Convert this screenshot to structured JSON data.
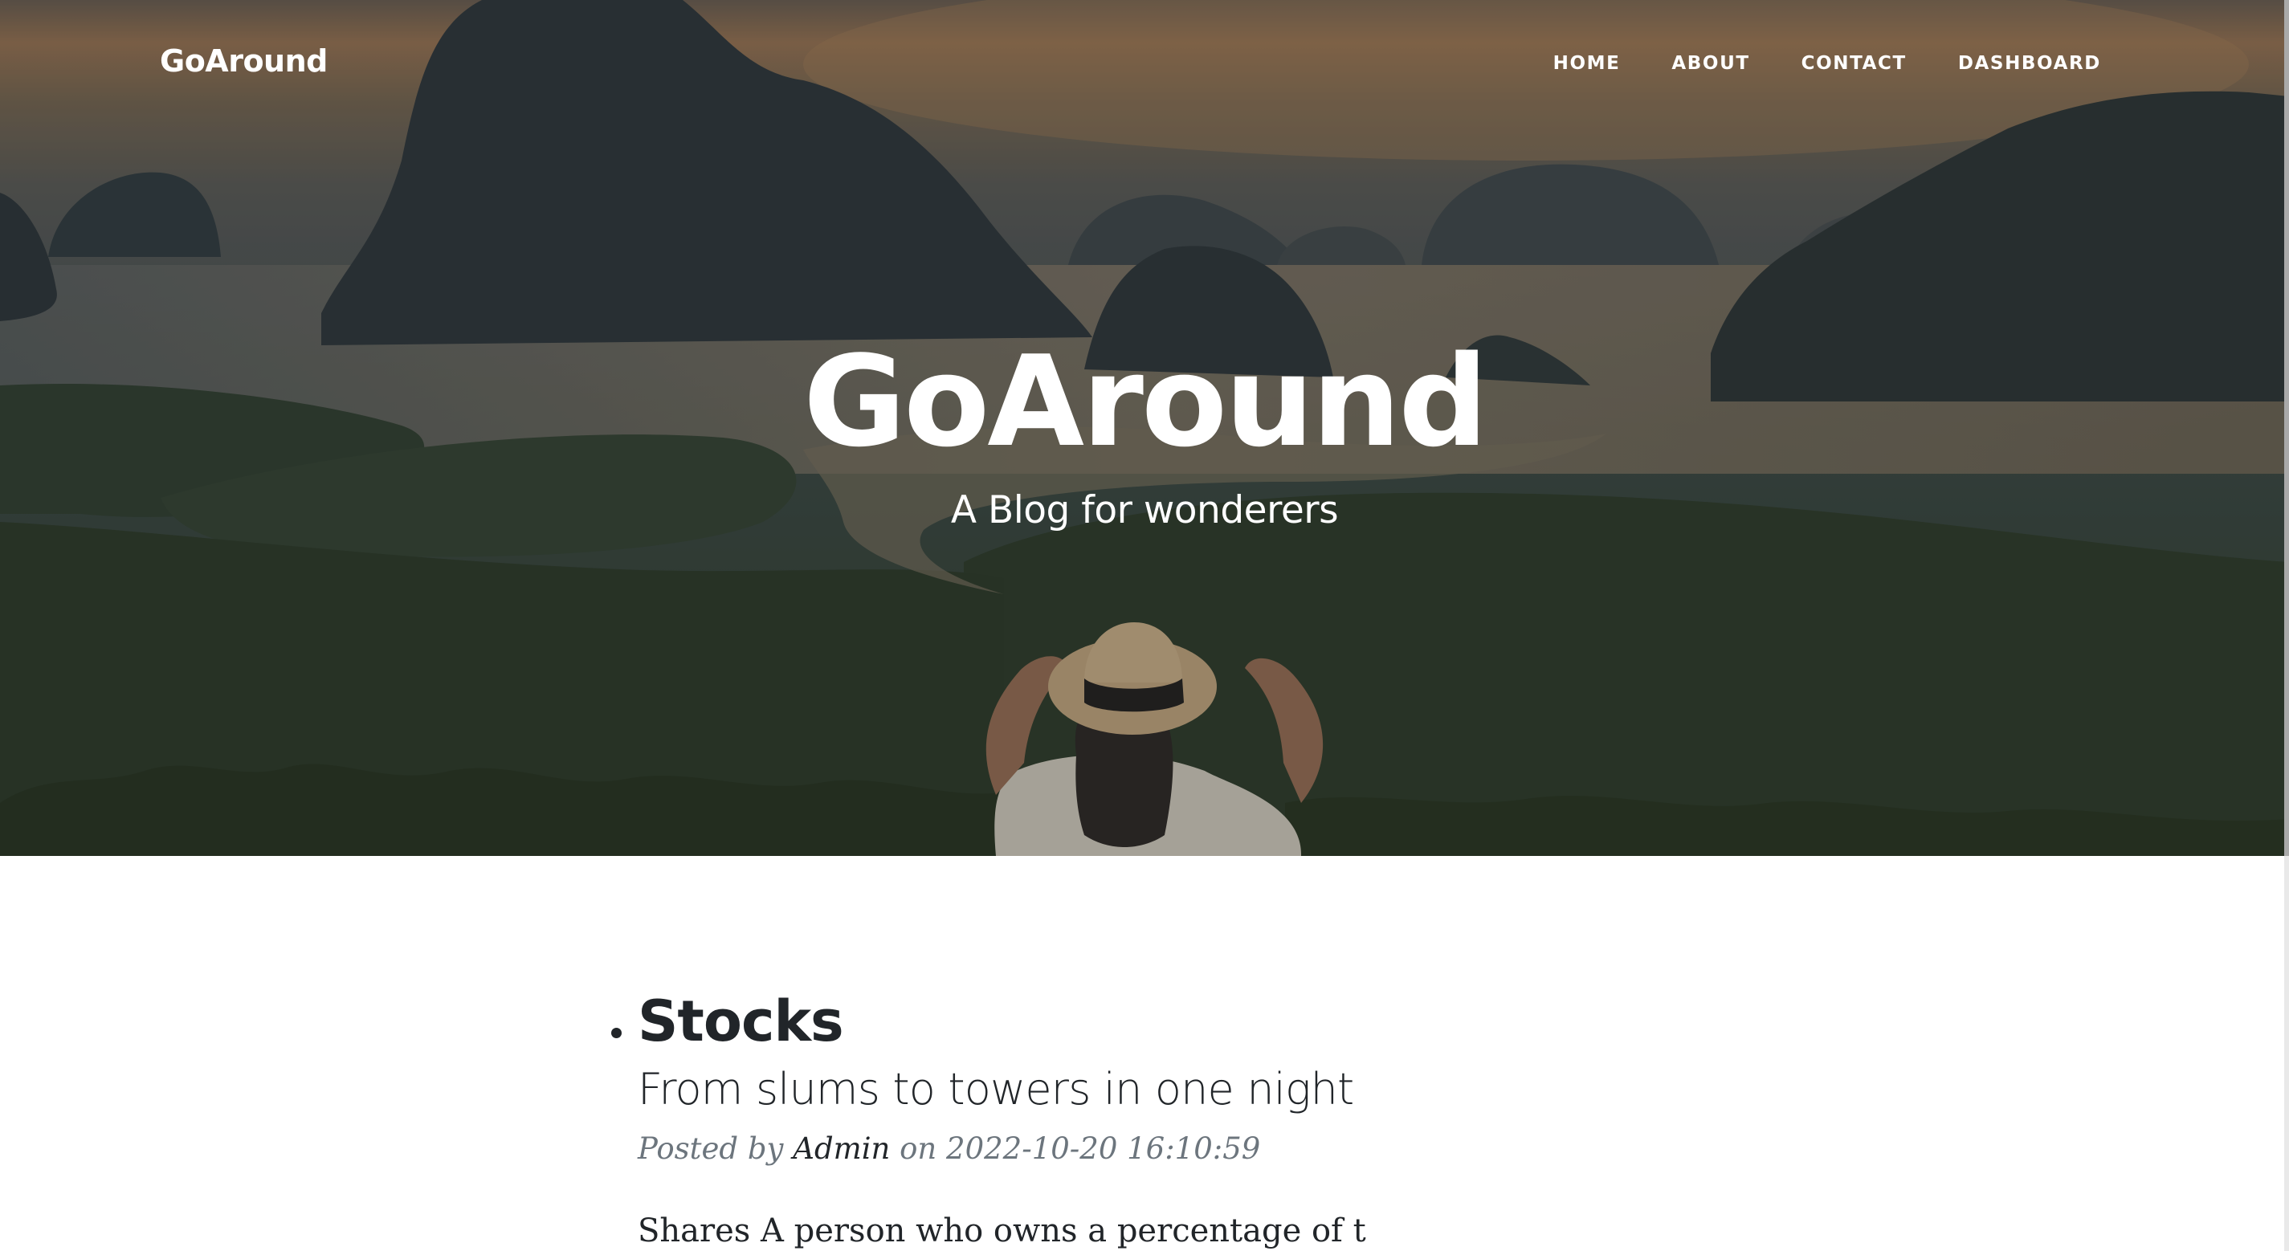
{
  "navbar": {
    "brand": "GoAround",
    "links": [
      {
        "label": "HOME"
      },
      {
        "label": "ABOUT"
      },
      {
        "label": "CONTACT"
      },
      {
        "label": "DASHBOARD"
      }
    ]
  },
  "hero": {
    "title": "GoAround",
    "subtitle": "A Blog for wonderers"
  },
  "posts": [
    {
      "title": "Stocks",
      "subtitle": "From slums to towers in one night",
      "meta_prefix": "Posted by",
      "author": "Admin",
      "meta_on": "on",
      "date": "2022-10-20 16:10:59",
      "excerpt": "Shares A person who owns a percentage of t"
    }
  ],
  "colors": {
    "text_dark": "#212529",
    "text_muted": "#6c757d",
    "hero_text": "#ffffff"
  }
}
